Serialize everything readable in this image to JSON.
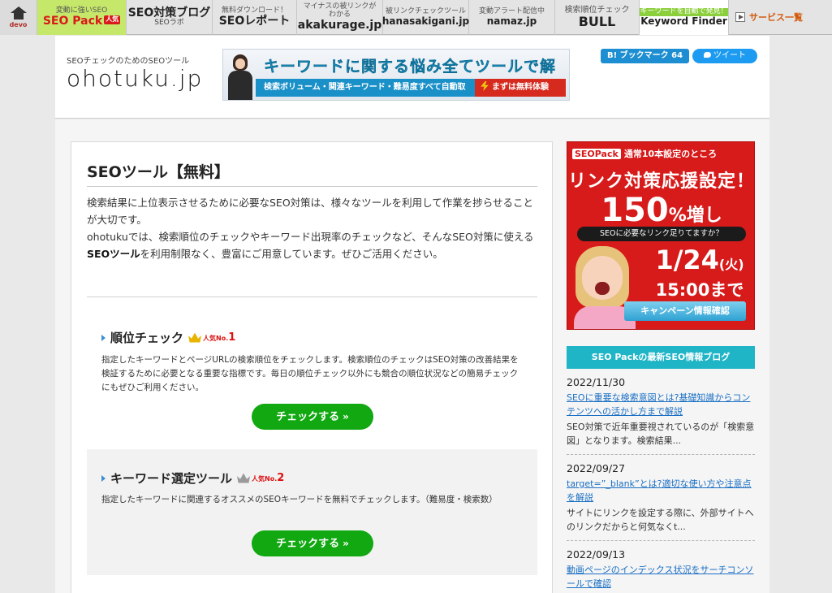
{
  "topnav": {
    "home_label": "devo",
    "items": [
      {
        "top": "変動に強いSEO",
        "main": "SEO Pack",
        "badge": "人気",
        "sub": ""
      },
      {
        "top": "",
        "main": "SEO対策ブログ",
        "sub": "SEOラボ"
      },
      {
        "top": "無料ダウンロード！",
        "main": "SEOレポート",
        "sub": ""
      },
      {
        "top": "マイナスの被リンクがわかる",
        "main": "akakurage.jp",
        "sub": ""
      },
      {
        "top": "被リンクチェックツール",
        "main": "hanasakigani.jp",
        "sub": ""
      },
      {
        "top": "変動アラート配信中",
        "main": "namaz.jp",
        "sub": ""
      },
      {
        "top": "検索順位チェック",
        "main": "BULL",
        "sub": ""
      },
      {
        "top": "キーワードを自動で発見！",
        "main": "Keyword Finder",
        "sub": ""
      }
    ],
    "service_list": "サービス一覧"
  },
  "header": {
    "tagline": "SEOチェックのためのSEOツール",
    "logo": "ohotuku.jp",
    "banner": {
      "title": "キーワードに関する悩み全てツールで解決！",
      "sub": "検索ボリューム・関連キーワード・難易度すべて自動取得！",
      "cta": "まずは無料体験"
    },
    "bookmark": "B! ブックマーク 64",
    "tweet": "ツイート"
  },
  "main": {
    "title": "SEOツール【無料】",
    "intro_1": "検索結果に上位表示させるために必要なSEO対策は、様々なツールを利用して作業を捗らせることが大切です。",
    "intro_2a": "ohotukuでは、検索順位のチェックやキーワード出現率のチェックなど、そんなSEO対策に使える",
    "intro_2b": "SEOツール",
    "intro_2c": "を利用制限なく、豊富にご用意しています。ぜひご活用ください。",
    "tools": [
      {
        "name": "順位チェック",
        "rank_label": "人気No.",
        "rank_num": "1",
        "desc": "指定したキーワードとページURLの検索順位をチェックします。検索順位のチェックはSEO対策の改善結果を検証するために必要となる重要な指標です。毎日の順位チェック以外にも競合の順位状況などの簡易チェックにもぜひご利用ください。",
        "button": "チェックする"
      },
      {
        "name": "キーワード選定ツール",
        "rank_label": "人気No.",
        "rank_num": "2",
        "desc": "指定したキーワードに関連するオススメのSEOキーワードを無料でチェックします。（難易度・検索数）",
        "button": "チェックする"
      }
    ]
  },
  "sidebar": {
    "ad": {
      "tag": "SEOPack",
      "top": "通常10本設定のところ",
      "line1": "リンク対策応援設定！",
      "big": "150",
      "big_unit": "%増し",
      "question": "SEOに必要なリンク足りてますか？",
      "date": "1/24",
      "date_day": "(火)",
      "time": "15:00まで",
      "cta": "キャンペーン情報確認"
    },
    "blog_heading": "SEO Packの最新SEO情報ブログ",
    "blog": [
      {
        "date": "2022/11/30",
        "title": "SEOに重要な検索意図とは?基礎知識からコンテンツへの活かし方まで解説",
        "excerpt": "SEO対策で近年重要視されているのが「検索意図」となります。検索結果..."
      },
      {
        "date": "2022/09/27",
        "title": "target=”_blank”とは?適切な使い方や注意点を解説",
        "excerpt": "サイトにリンクを設定する際に、外部サイトへのリンクだからと何気なくt..."
      },
      {
        "date": "2022/09/13",
        "title": "動画ページのインデックス状況をサーチコンソールで確認",
        "excerpt": ""
      }
    ]
  }
}
